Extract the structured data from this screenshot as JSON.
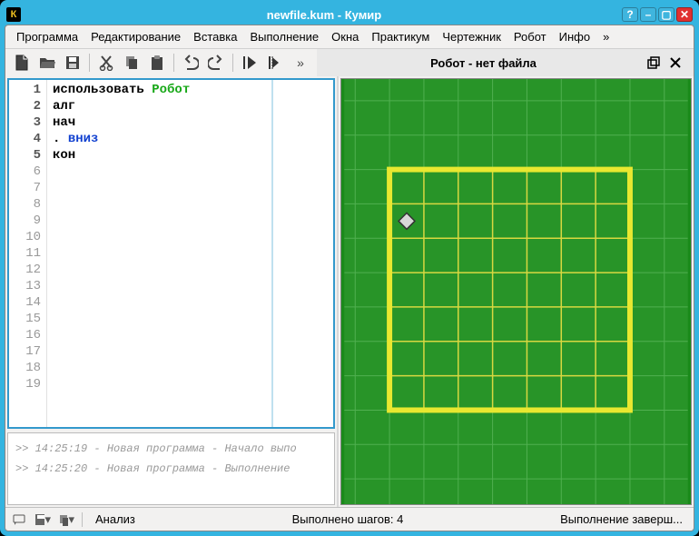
{
  "window": {
    "title": "newfile.kum - Кумир"
  },
  "menu": {
    "program": "Программа",
    "edit": "Редактирование",
    "insert": "Вставка",
    "run": "Выполнение",
    "windows": "Окна",
    "prakt": "Практикум",
    "drawer": "Чертежник",
    "robot": "Робот",
    "info": "Инфо",
    "more": "»"
  },
  "toolbar": {
    "more": "»"
  },
  "robot_panel": {
    "title": "Робот - нет файла"
  },
  "editor": {
    "lines": [
      {
        "n": "1",
        "pre": "использовать ",
        "kw": "Робот",
        "kwcls": "kw-green"
      },
      {
        "n": "2",
        "pre": "алг"
      },
      {
        "n": "3",
        "pre": "нач"
      },
      {
        "n": "4",
        "pre": ". ",
        "kw": "вниз",
        "kwcls": "kw-blue"
      },
      {
        "n": "5",
        "pre": "кон"
      }
    ],
    "empty_start": 6,
    "empty_end": 19
  },
  "console": {
    "l1": ">> 14:25:19 - Новая программа - Начало выпо",
    "l2": ">> 14:25:20 - Новая программа - Выполнение"
  },
  "status": {
    "analysis": "Анализ",
    "steps": "Выполнено шагов: 4",
    "state": "Выполнение заверш..."
  }
}
